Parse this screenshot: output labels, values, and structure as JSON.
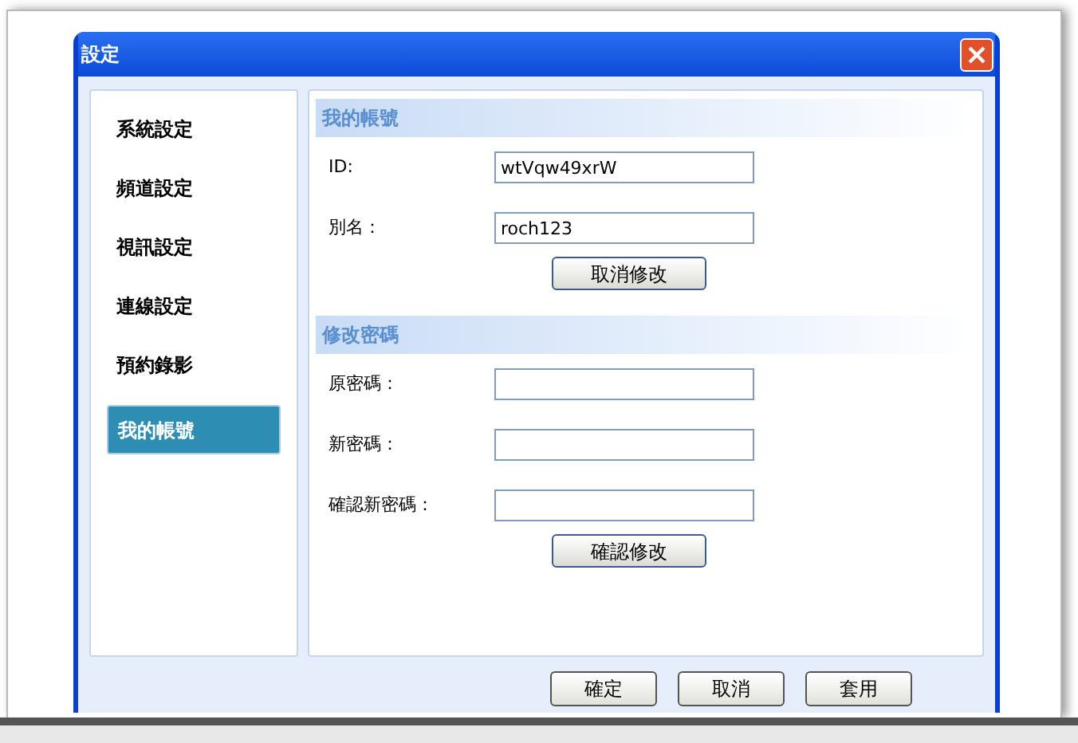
{
  "window": {
    "title": "設定"
  },
  "sidebar": {
    "items": [
      {
        "label": "系統設定",
        "selected": false
      },
      {
        "label": "頻道設定",
        "selected": false
      },
      {
        "label": "視訊設定",
        "selected": false
      },
      {
        "label": "連線設定",
        "selected": false
      },
      {
        "label": "預約錄影",
        "selected": false
      },
      {
        "label": "我的帳號",
        "selected": true
      }
    ]
  },
  "sections": [
    {
      "title": "我的帳號",
      "fields": [
        {
          "label": "ID:",
          "value": "wtVqw49xrW"
        },
        {
          "label": "別名：",
          "value": "roch123"
        }
      ],
      "button": "取消修改"
    },
    {
      "title": "修改密碼",
      "fields": [
        {
          "label": "原密碼："
        },
        {
          "label": "新密碼："
        },
        {
          "label": "確認新密碼："
        }
      ],
      "button": "確認修改"
    }
  ],
  "buttons": [
    "確定",
    "取消",
    "套用"
  ]
}
